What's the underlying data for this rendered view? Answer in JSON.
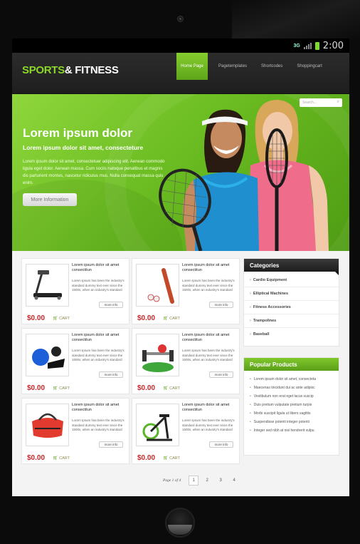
{
  "status_bar": {
    "network": "3G",
    "time": "2:00"
  },
  "header": {
    "logo_part1": "SPORTS",
    "logo_part2": "& FITNESS"
  },
  "nav": [
    {
      "label": "Home Page",
      "active": true
    },
    {
      "label": "Pagetemplates"
    },
    {
      "label": "Shortcodes"
    },
    {
      "label": "Shoppingcart"
    }
  ],
  "hero": {
    "search_placeholder": "Search...",
    "title": "Lorem ipsum dolor",
    "subtitle": "Lorem ipsum dolor sit amet, consecteture",
    "body": "Lorem ipsum dolor sit amet, consectetuer adipiscing elit. Aenean commodo ligula eget dolor. Aenean massa. Cum sociis natoque penatibus et magnis dis parturient montes, nascetur ridiculus mus. Nulla consequat massa quis enim.",
    "button": "More Information"
  },
  "products": [
    {
      "title": "Lorem ipsum dolor sit amet consectitun",
      "desc": "Lorem Ipsum has been the industry's standard dummy text ever since the 1500s, when an industry's standard",
      "more": "more info",
      "price": "$0.00",
      "cart": "CART",
      "icon": "treadmill-icon"
    },
    {
      "title": "Lorem ipsum dolor sit amet consectitun",
      "desc": "Lorem Ipsum has been the industry's standard dummy text ever since the 1500s, when an industry's standard",
      "more": "more info",
      "price": "$0.00",
      "cart": "CART",
      "icon": "baseball-bat-icon"
    },
    {
      "title": "Lorem ipsum dolor sit amet consectitun",
      "desc": "Lorem Ipsum has been the industry's standard dummy text ever since the 1500s, when an industry's standard",
      "more": "more info",
      "price": "$0.00",
      "cart": "CART",
      "icon": "fitness-gear-icon"
    },
    {
      "title": "Lorem ipsum dolor sit amet consectitun",
      "desc": "Lorem Ipsum has been the industry's standard dummy text ever since the 1500s, when an industry's standard",
      "more": "more info",
      "price": "$0.00",
      "cart": "CART",
      "icon": "dumbbell-icon"
    },
    {
      "title": "Lorem ipsum dolor sit amet consectitun",
      "desc": "Lorem Ipsum has been the industry's standard dummy text ever since the 1500s, when an industry's standard",
      "more": "more info",
      "price": "$0.00",
      "cart": "CART",
      "icon": "sports-bag-icon"
    },
    {
      "title": "Lorem ipsum dolor sit amet consectitun",
      "desc": "Lorem Ipsum has been the industry's standard dummy text ever since the 1500s, when an industry's standard",
      "more": "more info",
      "price": "$0.00",
      "cart": "CART",
      "icon": "exercise-bike-icon"
    }
  ],
  "categories": {
    "title": "Categories",
    "items": [
      "Cardio Equipment",
      "Elliptical Machines",
      "Fitness Accessories",
      "Trampolines",
      "Baseball"
    ]
  },
  "popular": {
    "title": "Popular Products",
    "items": [
      "Lorem ipsum dolor sit amet, consecteta",
      "Maecenas tincidunt dui ac ante adipisc",
      "Vestibulum non erat eget lacus suscip",
      "Duis pretium vulputate pretium turpis",
      "Morbi suscipit ligula ut libero sagittis",
      "Suspendisse potenti integer potenti",
      "Integer sed nibh at nisi hendrerit vulpu"
    ]
  },
  "pager": {
    "info": "Page 1 of 4",
    "pages": [
      "1",
      "2",
      "3",
      "4"
    ],
    "current": "1"
  },
  "colors": {
    "accent": "#7cc72a",
    "price": "#c8282a",
    "header_bg": "#222222"
  }
}
